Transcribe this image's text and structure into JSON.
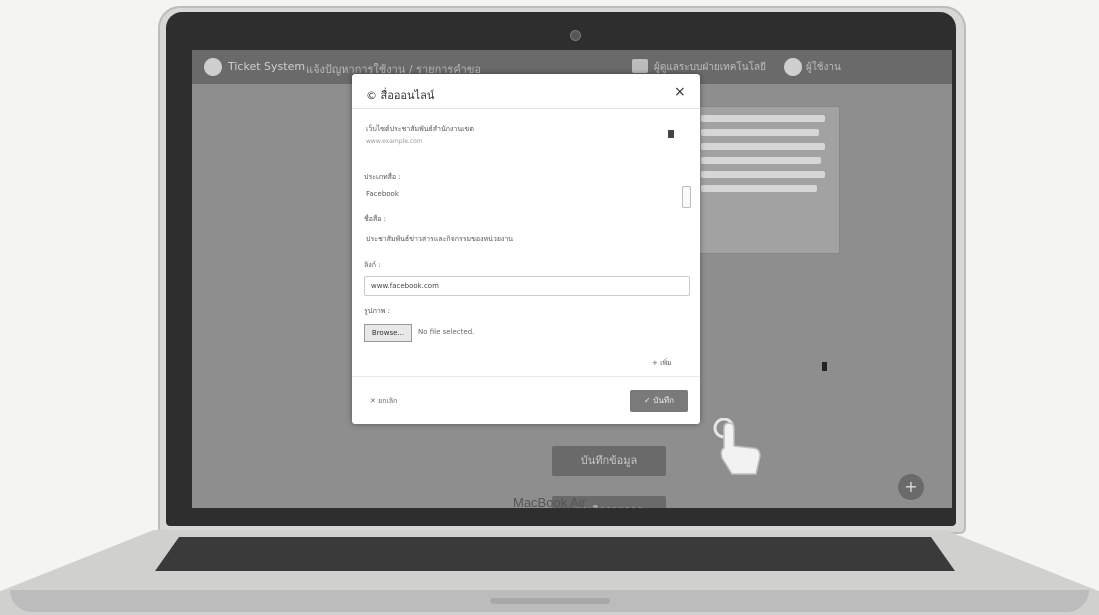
{
  "screen": {
    "header": {
      "app_title": "Ticket System",
      "breadcrumb": "แจ้งปัญหาการใช้งาน / รายการคำขอ",
      "user_label": "ผู้ดูแลระบบฝ่ายเทคโนโลยี",
      "user_name": "ผู้ใช้งาน"
    },
    "bg_buttons": [
      {
        "label": "บันทึกข้อมูล"
      },
      {
        "label": "ยกเลิกรายการ"
      }
    ],
    "fab_label": "+"
  },
  "modal": {
    "title": "© สื่อออนไลน์",
    "close": "×",
    "item": {
      "title": "เว็บไซต์ประชาสัมพันธ์สำนักงานเขต",
      "subtitle": "www.example.com"
    },
    "fields": {
      "type_label": "ประเภทสื่อ :",
      "type_value": "Facebook",
      "name_label": "ชื่อสื่อ :",
      "name_value": "ประชาสัมพันธ์ข่าวสารและกิจกรรมของหน่วยงาน",
      "link_label": "ลิงก์ :",
      "link_value": "www.facebook.com",
      "image_label": "รูปภาพ :"
    },
    "browse_label": "Browse...",
    "file_status": "No file selected.",
    "add_label": "+ เพิ่ม",
    "cancel_label": "✕ ยกเลิก",
    "save_label": "✓ บันทึก"
  },
  "device_brand": "MacBook Air",
  "colors": {
    "screen_bg": "#8e8e8e",
    "header": "#6a6a6a",
    "save_button": "#7a7a7a"
  }
}
